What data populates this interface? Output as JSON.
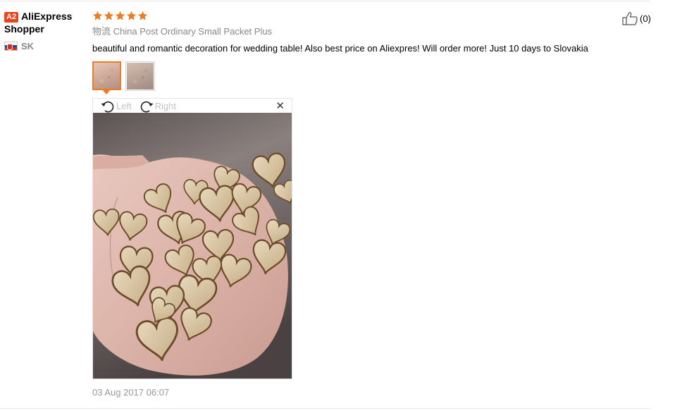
{
  "reviewer": {
    "level_badge": "A2",
    "name": "AliExpress Shopper",
    "country_code": "SK",
    "flag_icon": "slovakia-flag-icon"
  },
  "review": {
    "rating": 5,
    "rating_max": 5,
    "star_color": "#f07a1f",
    "shipping_prefix": "物流",
    "shipping_method": "China Post Ordinary Small Packet Plus",
    "text": "beautiful and romantic decoration for wedding table! Also best price on Aliexpres! Will order more! Just 10 days to Slovakia",
    "date": "03 Aug 2017 06:07"
  },
  "helpful": {
    "icon": "thumbs-up-icon",
    "count": "(0)"
  },
  "photos": {
    "thumbnails": [
      {
        "icon": "photo-thumbnail",
        "active": true
      },
      {
        "icon": "photo-thumbnail",
        "active": false
      }
    ],
    "viewer": {
      "rotate_left_label": "Left",
      "rotate_right_label": "Right",
      "close_icon": "close-icon",
      "accent_color": "#f07a1f"
    }
  }
}
